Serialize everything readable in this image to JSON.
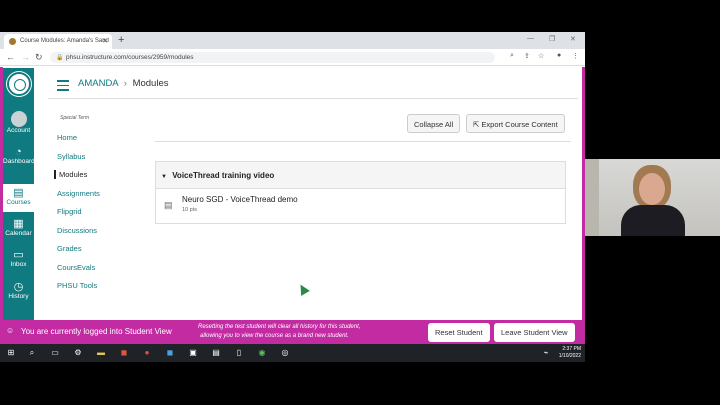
{
  "browser": {
    "tab_title": "Course Modules: Amanda's Sand",
    "url": "phsu.instructure.com/courses/2959/modules"
  },
  "global_nav": [
    {
      "label": "Account"
    },
    {
      "label": "Dashboard"
    },
    {
      "label": "Courses"
    },
    {
      "label": "Calendar"
    },
    {
      "label": "Inbox"
    },
    {
      "label": "History"
    }
  ],
  "breadcrumb": {
    "course": "AMANDA",
    "separator": "›",
    "page": "Modules"
  },
  "course_nav": {
    "term": "Special Term",
    "items": [
      "Home",
      "Syllabus",
      "Modules",
      "Assignments",
      "Flipgrid",
      "Discussions",
      "Grades",
      "CoursEvals",
      "PHSU Tools"
    ]
  },
  "toolbar": {
    "collapse_all": "Collapse All",
    "export": "Export Course Content"
  },
  "module": {
    "title": "VoiceThread training video",
    "items": [
      {
        "title": "Neuro SGD - VoiceThread demo",
        "points": "10 pts"
      }
    ]
  },
  "student_view": {
    "message": "You are currently logged into Student View",
    "note_line1": "Resetting the test student will clear all history for this student,",
    "note_line2": "allowing you to view the course as a brand new student.",
    "reset_label": "Reset Student",
    "leave_label": "Leave Student View"
  },
  "taskbar": {
    "time": "2:37 PM",
    "date": "1/10/2022"
  }
}
